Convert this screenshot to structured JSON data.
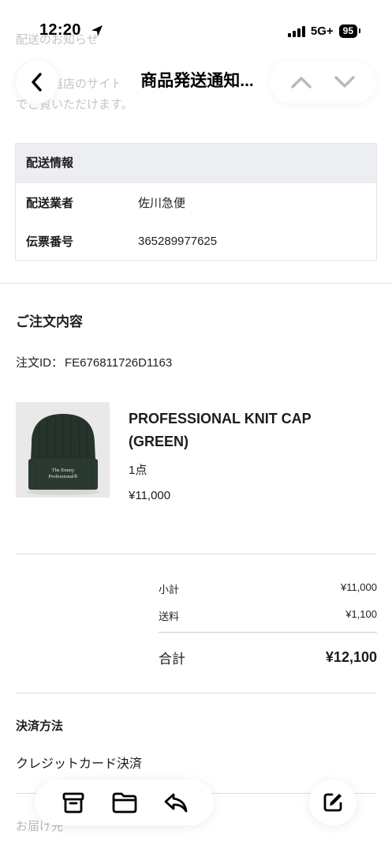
{
  "status_bar": {
    "time": "12:20",
    "network": "5G+",
    "battery": "95"
  },
  "header": {
    "title": "商品発送通知..."
  },
  "faded_text": {
    "line1": "配送のお知らせ",
    "line2": "詳細は当店のサイト",
    "line3": "でご覧いただけます。"
  },
  "shipping": {
    "header": "配送情報",
    "rows": [
      {
        "key": "配送業者",
        "value": "佐川急便"
      },
      {
        "key": "伝票番号",
        "value": "365289977625"
      }
    ]
  },
  "order": {
    "title": "ご注文内容",
    "id_label": "注文ID：",
    "id_value": "FE676811726D1163",
    "product": {
      "name_line1": "PROFESSIONAL KNIT CAP",
      "name_line2": "(GREEN)",
      "quantity": "1点",
      "price": "¥11,000",
      "image_text_line1": "The Ennoy",
      "image_text_line2": "Professional®"
    },
    "summary": {
      "subtotal_label": "小計",
      "subtotal_value": "¥11,000",
      "shipping_label": "送料",
      "shipping_value": "¥1,100",
      "total_label": "合計",
      "total_value": "¥12,100"
    }
  },
  "payment": {
    "title": "決済方法",
    "method": "クレジットカード決済"
  },
  "faded_bottom": "お届け先",
  "icons": {
    "back": "chevron-left-icon",
    "up": "chevron-up-icon",
    "down": "chevron-down-icon",
    "archive": "archive-icon",
    "folder": "folder-icon",
    "reply": "reply-icon",
    "compose": "compose-icon"
  }
}
